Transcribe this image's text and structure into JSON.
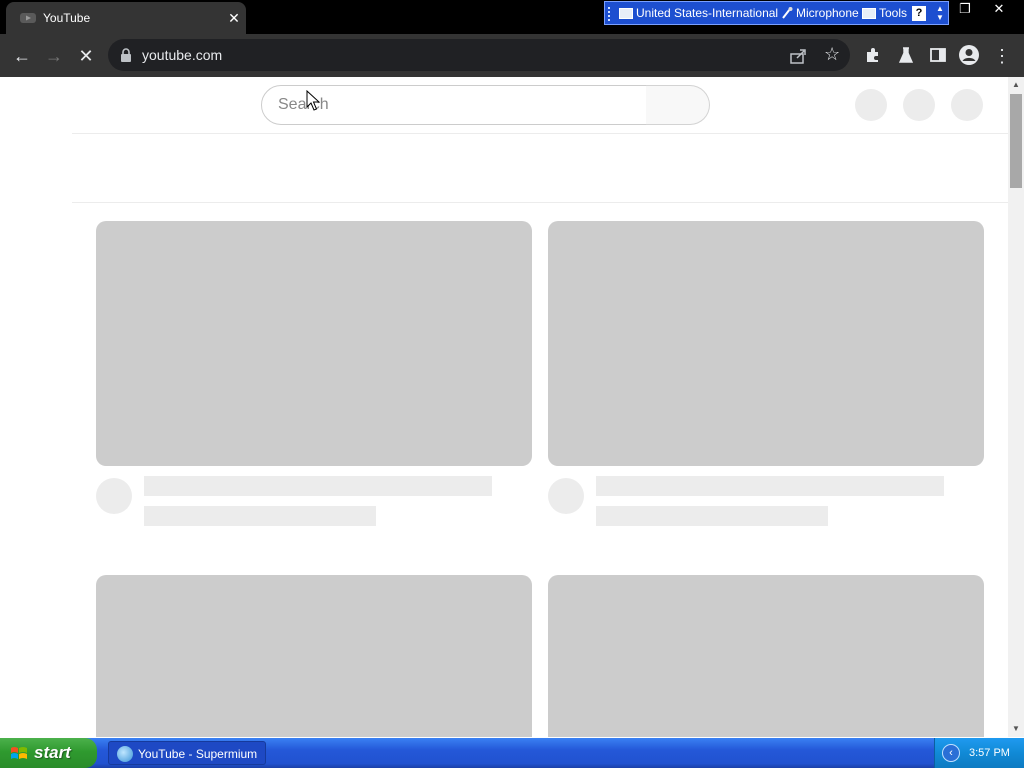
{
  "browser": {
    "tab": {
      "title": "YouTube",
      "close_glyph": "✕",
      "favicon": "youtube-favicon-icon"
    },
    "toolbar": {
      "back": "←",
      "forward": "→",
      "stop": "✕",
      "url": "youtube.com",
      "star": "☆",
      "menu": "⋮"
    },
    "window_controls": {
      "restore": "❐",
      "close": "✕"
    }
  },
  "language_bar": {
    "language": "United States-International",
    "microphone": "Microphone",
    "tools": "Tools",
    "help": "?"
  },
  "youtube": {
    "search_placeholder": "Search"
  },
  "taskbar": {
    "start_label": "start",
    "task_item": "YouTube - Supermium",
    "clock": "3:57 PM"
  },
  "colors": {
    "chrome_dark": "#343434",
    "omnibox": "#202124",
    "skeleton": "#cccccc",
    "skeleton_light": "#ececec",
    "xp_blue": "#2458d8",
    "xp_green": "#2f9a2f"
  }
}
